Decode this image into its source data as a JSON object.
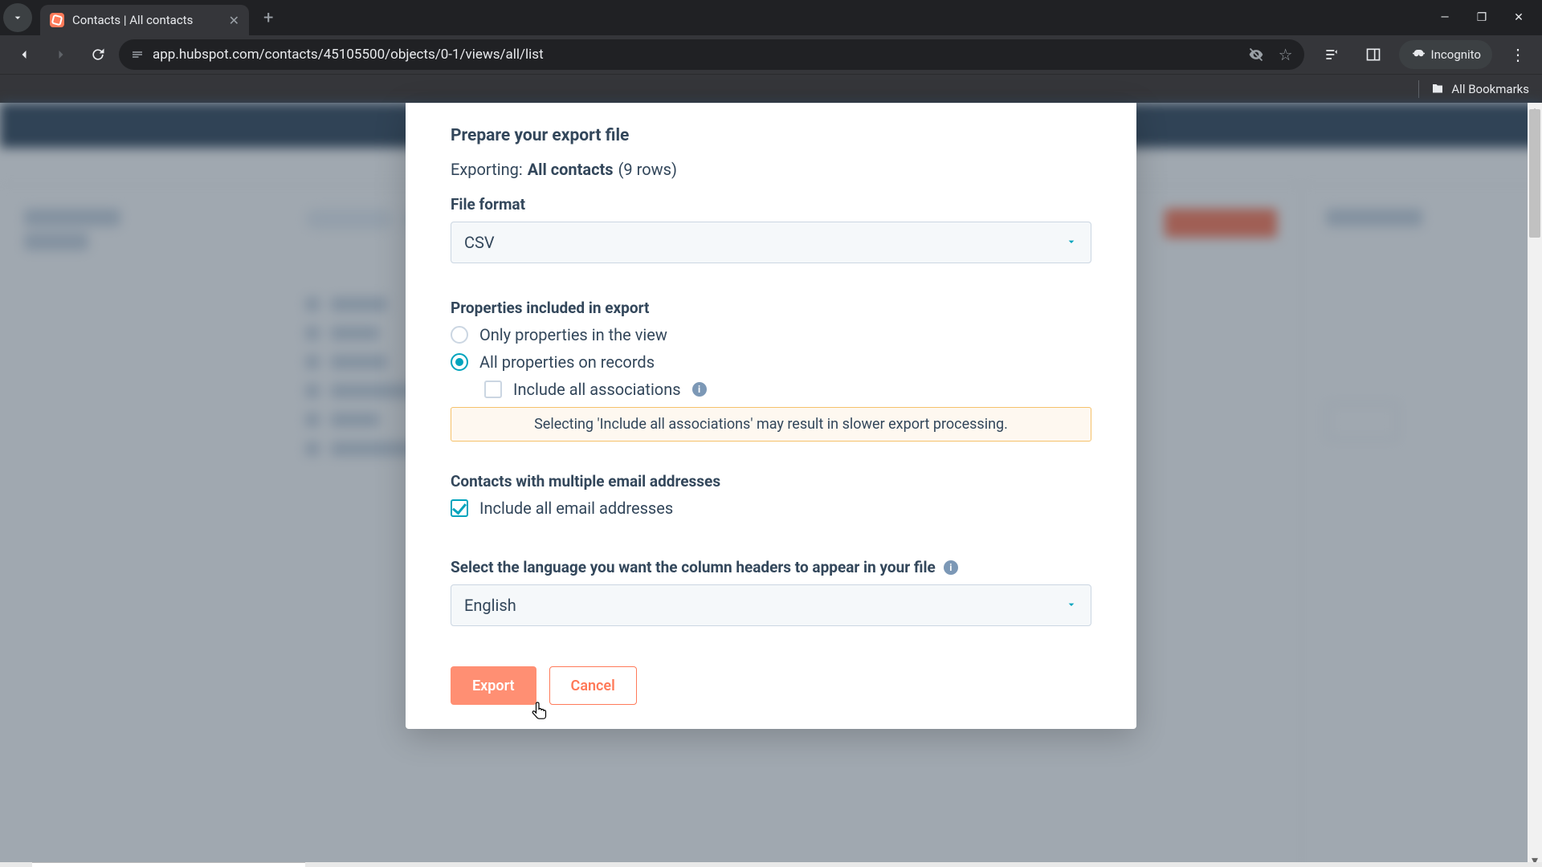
{
  "browser": {
    "tab_title": "Contacts | All contacts",
    "url": "app.hubspot.com/contacts/45105500/objects/0-1/views/all/list",
    "incognito_label": "Incognito",
    "all_bookmarks": "All Bookmarks"
  },
  "modal": {
    "heading": "Prepare your export file",
    "exporting_label": "Exporting:",
    "exporting_name": "All contacts",
    "exporting_rows": "(9 rows)",
    "file_format_label": "File format",
    "file_format_value": "CSV",
    "properties_label": "Properties included in export",
    "radio_only_view": "Only properties in the view",
    "radio_all_records": "All properties on records",
    "include_associations": "Include all associations",
    "associations_warning": "Selecting 'Include all associations' may result in slower export processing.",
    "multi_email_label": "Contacts with multiple email addresses",
    "include_all_emails": "Include all email addresses",
    "language_label": "Select the language you want the column headers to appear in your file",
    "language_value": "English",
    "export_btn": "Export",
    "cancel_btn": "Cancel"
  },
  "colors": {
    "accent_teal": "#00a4bd",
    "accent_orange": "#ff7a59",
    "text": "#33475b"
  }
}
